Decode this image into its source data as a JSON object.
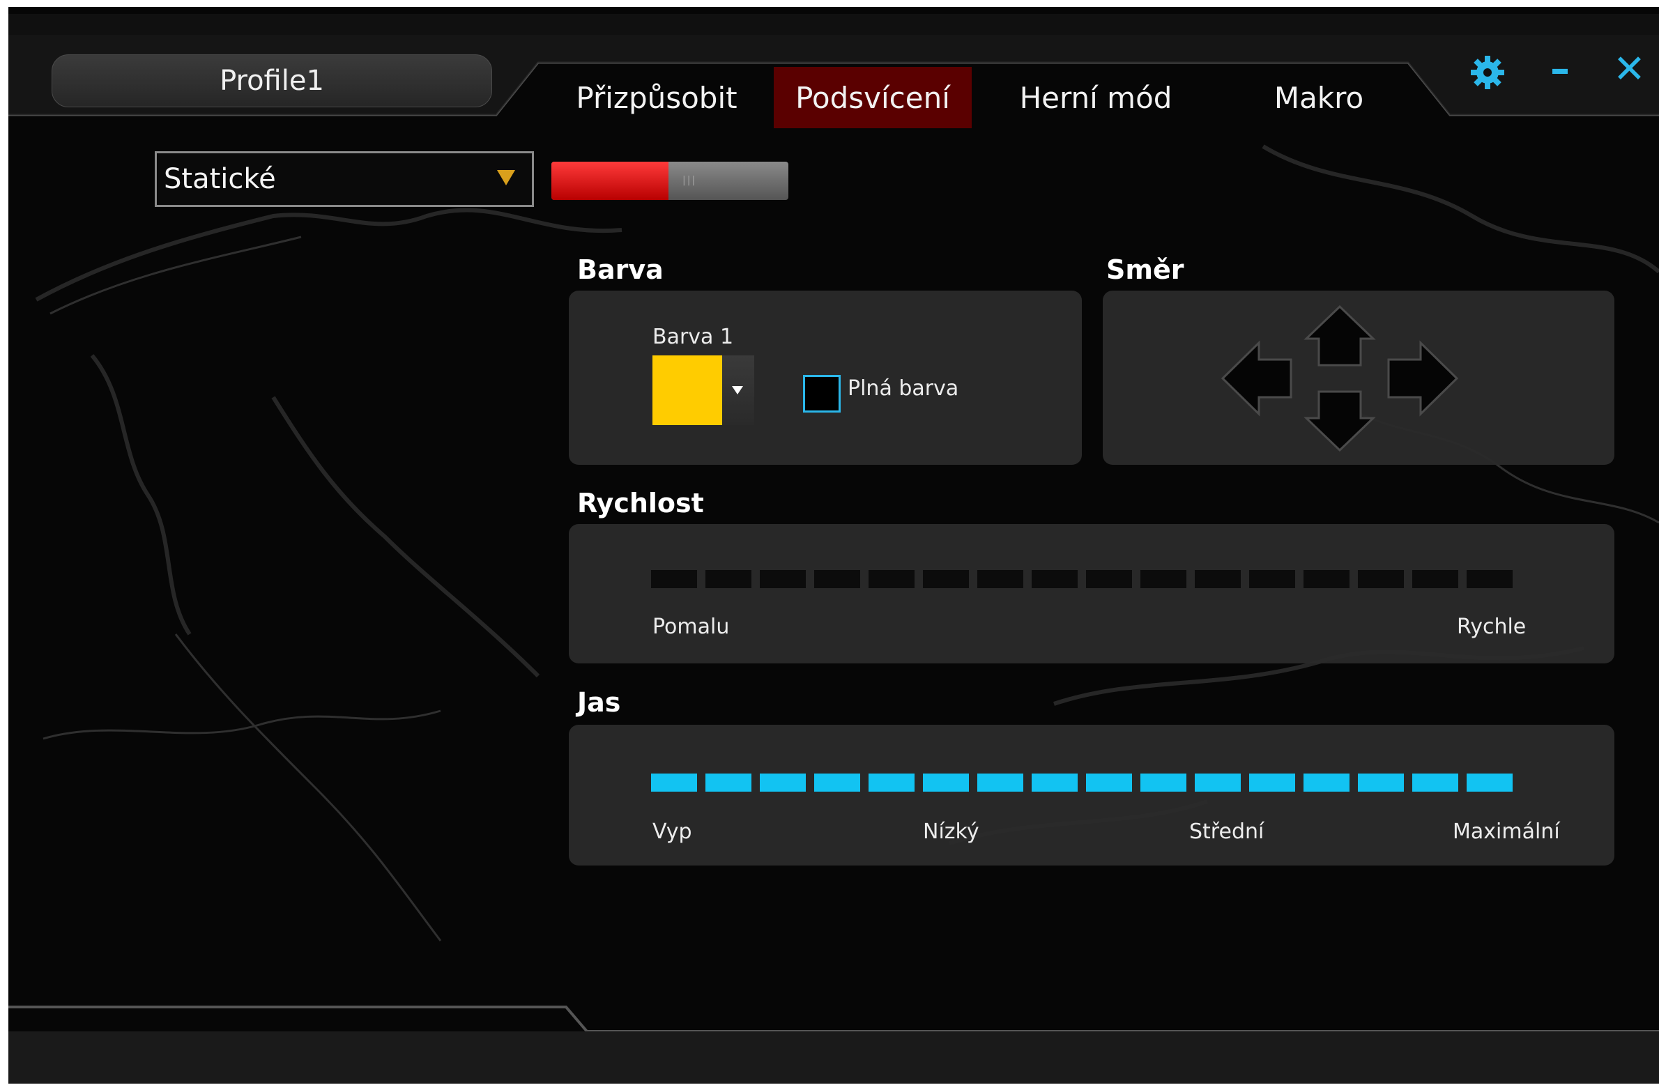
{
  "profile": {
    "name": "Profile1"
  },
  "tabs": [
    {
      "label": "Přizpůsobit",
      "active": false
    },
    {
      "label": "Podsvícení",
      "active": true
    },
    {
      "label": "Herní mód",
      "active": false
    },
    {
      "label": "Makro",
      "active": false
    }
  ],
  "window_controls": {
    "settings_icon": "gear-icon",
    "minimize": "–",
    "close": "✕"
  },
  "effect": {
    "selected": "Statické"
  },
  "lighting_toggle": {
    "on": true
  },
  "color_section": {
    "heading": "Barva",
    "color1_label": "Barva 1",
    "color1_value": "#ffcc00",
    "full_color_label": "Plná barva",
    "full_color_checked": false
  },
  "direction_section": {
    "heading": "Směr",
    "arrows": [
      "arrow-left-icon",
      "arrow-up-icon",
      "arrow-right-icon",
      "arrow-down-icon"
    ]
  },
  "speed_section": {
    "heading": "Rychlost",
    "min_label": "Pomalu",
    "max_label": "Rychle",
    "segments": 16,
    "level": 0
  },
  "brightness_section": {
    "heading": "Jas",
    "labels": [
      "Vyp",
      "Nízký",
      "Střední",
      "Maximální"
    ],
    "segments": 16,
    "level": 16
  },
  "colors": {
    "accent": "#2bb7ea",
    "active_tab": "#5a0000",
    "toggle_on": "#ff2020",
    "segment_on": "#12c3f2"
  }
}
